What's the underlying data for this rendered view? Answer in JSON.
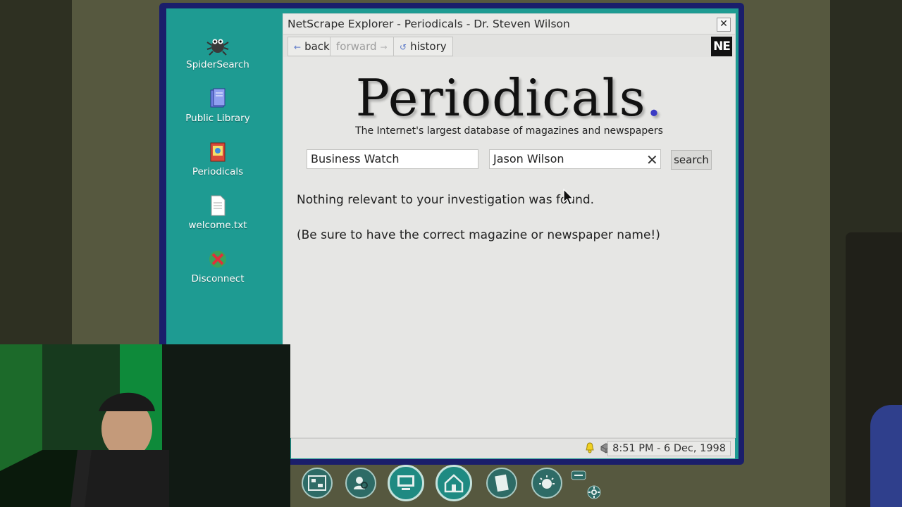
{
  "desktop": {
    "icons": [
      {
        "label": "SpiderSearch",
        "icon": "spider-icon"
      },
      {
        "label": "Public Library",
        "icon": "library-books-icon"
      },
      {
        "label": "Periodicals",
        "icon": "periodicals-icon"
      },
      {
        "label": "welcome.txt",
        "icon": "text-file-icon"
      },
      {
        "label": "Disconnect",
        "icon": "disconnect-icon"
      }
    ]
  },
  "window": {
    "title": "NetScrape Explorer - Periodicals - Dr. Steven Wilson",
    "close_label": "✕",
    "toolbar": {
      "back_label": "back",
      "forward_label": "forward",
      "history_label": "history",
      "logo_text": "NE"
    }
  },
  "page": {
    "brand_name": "Periodicals",
    "brand_dot": ".",
    "tagline": "The Internet's largest database of magazines and newspapers",
    "publication_field_value": "Business Watch",
    "person_field_value": "Jason Wilson",
    "search_label": "search",
    "result_message": "Nothing relevant to your investigation was found.",
    "hint_message": "(Be sure to have the correct magazine or newspaper name!)"
  },
  "statusbar": {
    "clock": "8:51 PM - 6 Dec, 1998"
  },
  "dock": {
    "buttons": [
      "evidence-board-icon",
      "search-person-icon",
      "computer-icon",
      "home-icon",
      "notebook-icon",
      "idea-icon"
    ],
    "extra": [
      "tag-icon",
      "settings-gear-icon"
    ]
  },
  "colors": {
    "desktop_teal": "#1e9b92",
    "monitor_bezel": "#1a1e6b",
    "brand_dot": "#3b3bc4"
  }
}
